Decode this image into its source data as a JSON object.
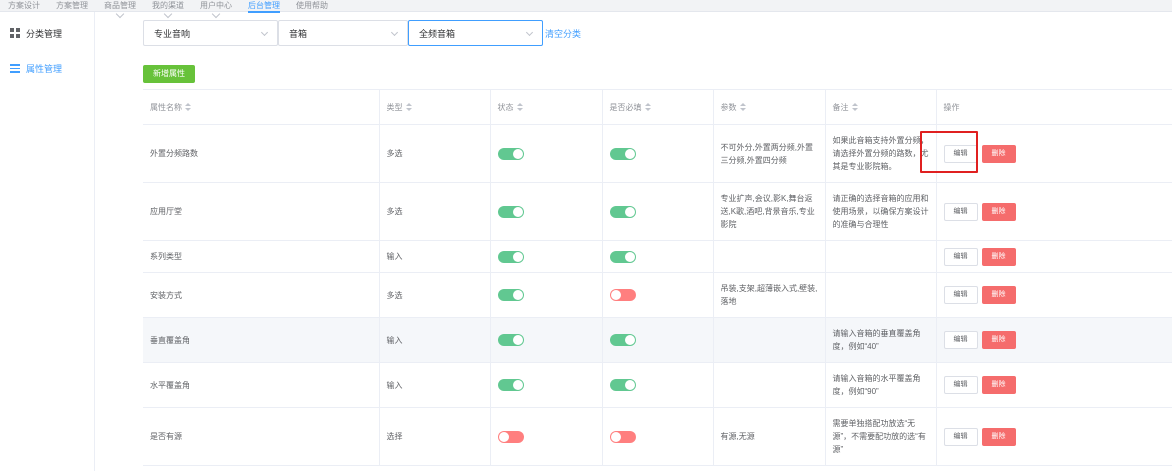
{
  "topnav": {
    "items": [
      "方案设计",
      "方案管理",
      "商品管理",
      "我的渠道",
      "用户中心",
      "后台管理",
      "使用帮助"
    ]
  },
  "sidebar": {
    "items": [
      {
        "label": "分类管理",
        "icon": "grid-icon"
      },
      {
        "label": "属性管理",
        "icon": "list-icon"
      }
    ]
  },
  "filters": {
    "select1": "专业音响",
    "select2": "音箱",
    "select3": "全频音箱",
    "clear": "清空分类"
  },
  "add_button": "新增属性",
  "table": {
    "headers": [
      "属性名称",
      "类型",
      "状态",
      "是否必填",
      "参数",
      "备注",
      "操作"
    ],
    "edit_label": "编辑",
    "delete_label": "删除",
    "rows": [
      {
        "name": "外置分频路数",
        "type": "多选",
        "status": "on",
        "required": "on",
        "params": "不可外分,外置两分频,外置三分频,外置四分频",
        "note": "如果此音箱支持外置分频，请选择外置分频的路数，尤其是专业影院箱。"
      },
      {
        "name": "应用厅堂",
        "type": "多选",
        "status": "on",
        "required": "on",
        "params": "专业扩声,会议,影K,舞台返送,K歌,酒吧,背景音乐,专业影院",
        "note": "请正确的选择音箱的应用和使用场景，以确保方案设计的准确与合理性"
      },
      {
        "name": "系列类型",
        "type": "输入",
        "status": "on",
        "required": "on",
        "params": "",
        "note": ""
      },
      {
        "name": "安装方式",
        "type": "多选",
        "status": "on",
        "required": "off",
        "params": "吊装,支架,超薄嵌入式,壁装,落地",
        "note": ""
      },
      {
        "name": "垂直覆盖角",
        "type": "输入",
        "status": "on",
        "required": "on",
        "params": "",
        "note": "请输入音箱的垂直覆盖角度，例如“40”"
      },
      {
        "name": "水平覆盖角",
        "type": "输入",
        "status": "on",
        "required": "on",
        "params": "",
        "note": "请输入音箱的水平覆盖角度，例如“90”"
      },
      {
        "name": "是否有源",
        "type": "选择",
        "status": "off",
        "required": "off",
        "params": "有源,无源",
        "note": "需要单独搭配功放选“无源”，不需要配功放的选“有源”"
      }
    ]
  },
  "colors": {
    "accent": "#409eff",
    "add": "#67c23a",
    "switch_on": "#61c891",
    "switch_off": "#ff7f7f",
    "delete": "#f56c6c",
    "highlight": "#e02020"
  }
}
